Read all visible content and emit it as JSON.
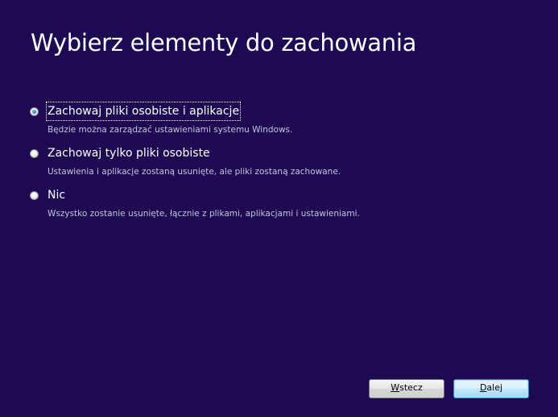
{
  "page": {
    "title": "Wybierz elementy do zachowania"
  },
  "options": [
    {
      "label": "Zachowaj pliki osobiste i aplikacje",
      "description": "Będzie można zarządzać ustawieniami systemu Windows.",
      "selected": true
    },
    {
      "label": "Zachowaj tylko pliki osobiste",
      "description": "Ustawienia i aplikacje zostaną usunięte, ale pliki zostaną zachowane.",
      "selected": false
    },
    {
      "label": "Nic",
      "description": "Wszystko zostanie usunięte, łącznie z plikami, aplikacjami i ustawieniami.",
      "selected": false
    }
  ],
  "buttons": {
    "back": {
      "accesskey": "W",
      "rest": "stecz"
    },
    "next": {
      "accesskey": "D",
      "rest": "alej"
    }
  },
  "colors": {
    "background": "#1d0a52",
    "text": "#ffffff",
    "description_text": "#c9c3de",
    "default_button_border": "#3c7fb1"
  }
}
